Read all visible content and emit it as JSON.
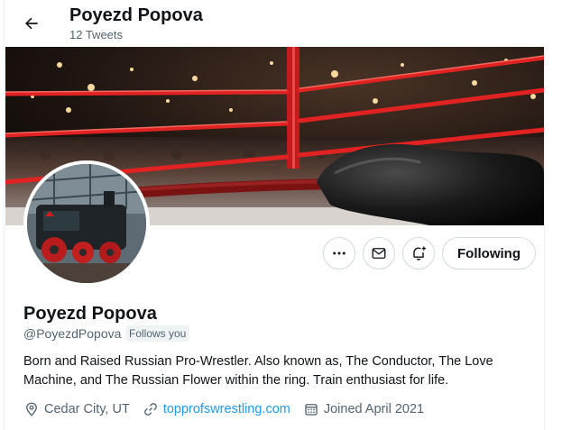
{
  "header": {
    "title": "Poyezd Popova",
    "tweet_count": "12 Tweets"
  },
  "profile": {
    "name": "Poyezd Popova",
    "handle": "@PoyezdPopova",
    "follows_you": "Follows you",
    "bio": "Born and Raised Russian Pro-Wrestler. Also known as, The Conductor, The Love Machine, and The Russian Flower within the ring. Train enthusiast for life.",
    "location": "Cedar City, UT",
    "website": "topprofswrestling.com",
    "joined": "Joined April 2021"
  },
  "actions": {
    "following_label": "Following"
  },
  "icons": {
    "back": "back-arrow-icon",
    "more": "more-icon",
    "message": "mail-icon",
    "notify": "notification-bell-icon",
    "location": "location-pin-icon",
    "link": "link-icon",
    "calendar": "calendar-icon"
  },
  "colors": {
    "accent": "#1d9bf0",
    "muted": "#536471",
    "text": "#0f1419",
    "ring_rope": "#d81f1f"
  }
}
